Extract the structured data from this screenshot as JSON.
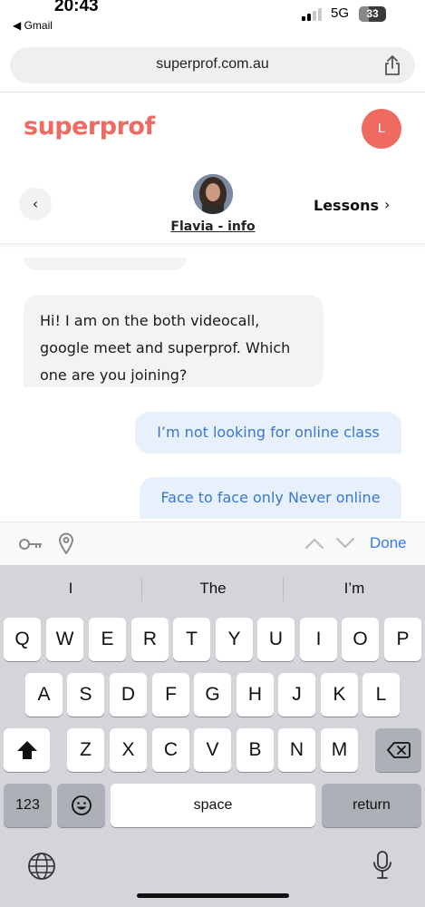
{
  "status_bar": {
    "time": "20:43",
    "back_app": "◀ Gmail",
    "network": "5G",
    "battery": "33"
  },
  "browser": {
    "url": "superprof.com.au",
    "share_icon": "share-icon"
  },
  "site": {
    "logo": "superprof",
    "user_initial": "L",
    "brand_color": "#ee6a63"
  },
  "chat_header": {
    "back_icon": "chevron-left-icon",
    "contact_name": "Flavia - info",
    "lessons_label": "Lessons",
    "lessons_chevron": "›"
  },
  "messages": [
    {
      "direction": "incoming",
      "text": "Hi! I am on the both videocall, google meet and superprof. Which one are you joining?"
    },
    {
      "direction": "outgoing",
      "text": "I’m not looking for online class"
    },
    {
      "direction": "outgoing",
      "text": "Face to face only Never online"
    }
  ],
  "accessory_bar": {
    "done_label": "Done"
  },
  "keyboard": {
    "suggestions": [
      "I",
      "The",
      "I’m"
    ],
    "row1": [
      "Q",
      "W",
      "E",
      "R",
      "T",
      "Y",
      "U",
      "I",
      "O",
      "P"
    ],
    "row2": [
      "A",
      "S",
      "D",
      "F",
      "G",
      "H",
      "J",
      "K",
      "L"
    ],
    "row3": [
      "Z",
      "X",
      "C",
      "V",
      "B",
      "N",
      "M"
    ],
    "numbers_label": "123",
    "space_label": "space",
    "return_label": "return"
  }
}
